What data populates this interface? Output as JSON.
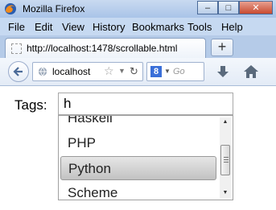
{
  "window": {
    "title": "Mozilla Firefox",
    "controls": {
      "minimize": "–",
      "maximize": "□",
      "close": "✕"
    }
  },
  "menu": [
    "File",
    "Edit",
    "View",
    "History",
    "Bookmarks",
    "Tools",
    "Help"
  ],
  "tab": {
    "title": "http://localhost:1478/scrollable.html",
    "new_tab": "+"
  },
  "navbar": {
    "url": "localhost",
    "search_placeholder": "Go",
    "search_engine_badge": "8"
  },
  "page": {
    "label": "Tags:",
    "input_value": "h",
    "options": [
      "Haskell",
      "PHP",
      "Python",
      "Scheme"
    ],
    "selected_option": "Python"
  }
}
